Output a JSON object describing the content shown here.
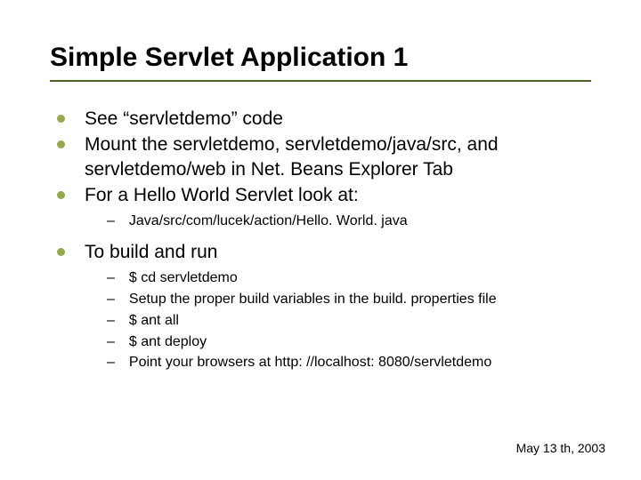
{
  "title": "Simple Servlet Application 1",
  "bullets": [
    {
      "text": "See “servletdemo” code"
    },
    {
      "text": "Mount the servletdemo, servletdemo/java/src, and servletdemo/web in Net. Beans Explorer Tab"
    },
    {
      "text": "For a Hello World Servlet look at:",
      "sub": [
        "Java/src/com/lucek/action/Hello. World. java"
      ]
    },
    {
      "text": "To build and run",
      "sub": [
        "$ cd servletdemo",
        "Setup the proper build variables in the build. properties file",
        "$ ant all",
        "$ ant deploy",
        "Point your browsers at http: //localhost: 8080/servletdemo"
      ]
    }
  ],
  "footer": "May 13 th, 2003"
}
